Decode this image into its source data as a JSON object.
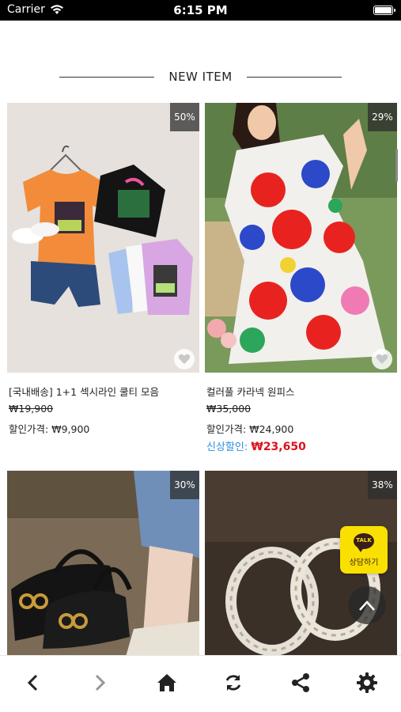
{
  "status_bar": {
    "carrier": "Carrier",
    "time": "6:15 PM"
  },
  "section": {
    "title": "NEW ITEM"
  },
  "products": [
    {
      "discount": "50%",
      "name": "[국내배송] 1+1 섹시라인 쿨티 모음",
      "original_price": "₩19,900",
      "sale_label": "할인가격:",
      "sale_price": "₩9,900"
    },
    {
      "discount": "29%",
      "name": "컬러풀 카라넥 원피스",
      "original_price": "₩35,000",
      "sale_label": "할인가격:",
      "sale_price": "₩24,900",
      "new_sale_label": "신상할인:",
      "new_sale_price": "₩23,650"
    },
    {
      "discount": "30%"
    },
    {
      "discount": "38%"
    }
  ],
  "kakao": {
    "badge": "TALK",
    "label": "상담하기"
  },
  "toolbar": {
    "back_icon": "chevron-left-icon",
    "forward_icon": "chevron-right-icon",
    "home_icon": "home-icon",
    "refresh_icon": "refresh-icon",
    "share_icon": "share-icon",
    "settings_icon": "gear-icon"
  },
  "colors": {
    "new_sale_label": "#2a8fe0",
    "new_sale_price": "#e0101a",
    "kakao_yellow": "#f9e000"
  }
}
